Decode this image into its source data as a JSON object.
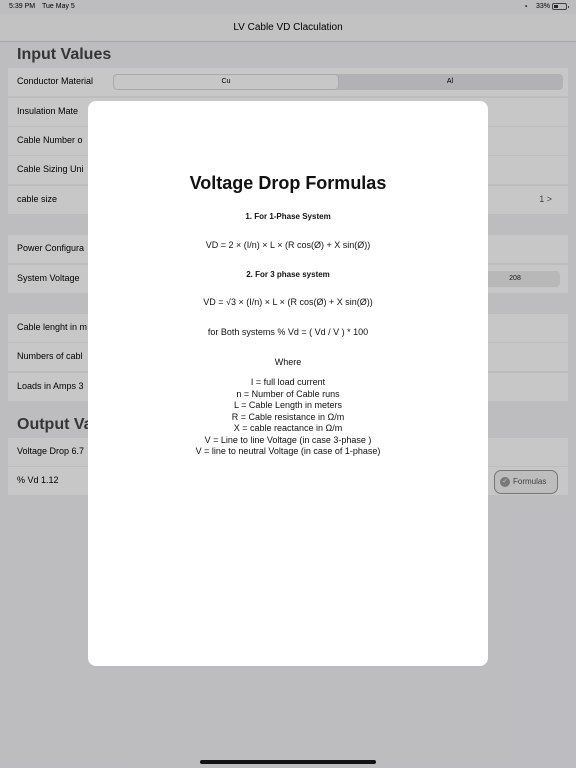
{
  "status_bar": {
    "time": "5:39 PM",
    "date": "Tue May 5",
    "battery": "33%"
  },
  "nav": {
    "title": "LV Cable VD Claculation"
  },
  "input_section": {
    "title": "Input Values",
    "conductor": {
      "label": "Conductor Material",
      "options": [
        "Cu",
        "Al"
      ],
      "selected": "Cu"
    },
    "insulation": {
      "label": "Insulation   Mate"
    },
    "cable_number": {
      "label": "Cable Number o"
    },
    "cable_sizing": {
      "label": "Cable Sizing Uni"
    },
    "cable_size": {
      "label": "cable size",
      "value": "1 >"
    },
    "power_config": {
      "label": "Power Configura"
    },
    "system_voltage": {
      "label": "System Voltage",
      "value": "208"
    },
    "cable_length": {
      "label": "Cable lenght in m"
    },
    "num_cables": {
      "label": "Numbers of cabl"
    },
    "loads": {
      "label": "Loads in Amps  3"
    }
  },
  "output_section": {
    "title": "Output Va",
    "voltage_drop": {
      "label": "Voltage Drop 6.7"
    },
    "percent_vd": {
      "label": "% Vd 1.12"
    },
    "formulas_button": "Formulas"
  },
  "modal": {
    "title": "Voltage Drop Formulas",
    "single_phase_heading": "1. For 1-Phase System",
    "single_phase_formula": "VD  =   2 × (I/n)  × L × (R cos(Ø) + X sin(Ø))",
    "three_phase_heading": "2. For 3 phase system",
    "three_phase_formula": "VD  =   √3 × (I/n)  × L × (R cos(Ø) + X sin(Ø))",
    "percent_formula": "for Both systems  % Vd = ( Vd / V ) * 100",
    "where_label": "Where",
    "definitions": [
      "I  = full load current",
      "n  = Number of Cable runs",
      "L  = Cable Length in meters",
      "R = Cable resistance in Ω/m",
      "X  = cable reactance in Ω/m",
      "V  = Line to line Voltage (in case 3-phase )",
      "V =  line to neutral Voltage (in case of 1-phase)"
    ]
  }
}
